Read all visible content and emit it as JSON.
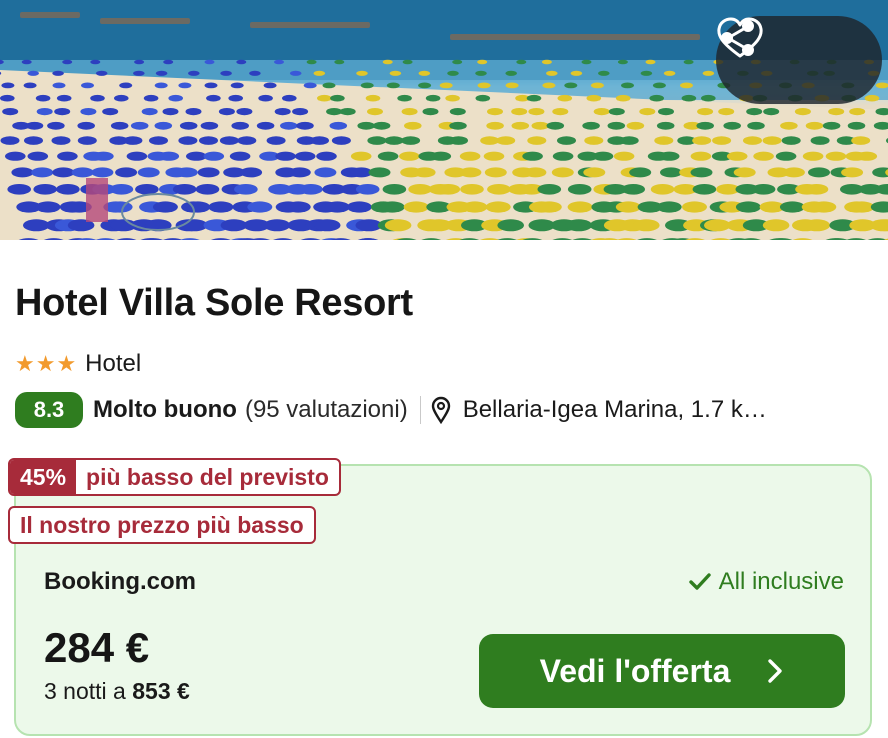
{
  "hero": {
    "share_icon": "share-icon",
    "favorite_icon": "heart-outline-icon"
  },
  "hotel": {
    "name": "Hotel Villa Sole Resort",
    "stars": "★★★",
    "star_count": 3,
    "type": "Hotel",
    "score": "8.3",
    "rating_word": "Molto buono",
    "rating_count": "(95 valutazioni)",
    "location": "Bellaria-Igea Marina, 1.7 k…"
  },
  "deal": {
    "discount_pct": "45%",
    "discount_text": "più basso del previsto",
    "best_price_label": "Il nostro prezzo più basso",
    "provider": "Booking.com",
    "inclusion": "All inclusive",
    "price": "284 €",
    "nights_prefix": "3 notti a ",
    "total": "853 €",
    "cta_label": "Vedi l'offerta"
  },
  "colors": {
    "accent_green": "#2f7d1f",
    "deal_red": "#a72b3a",
    "card_bg": "#ecf9ea",
    "star_orange": "#f29a2c"
  }
}
